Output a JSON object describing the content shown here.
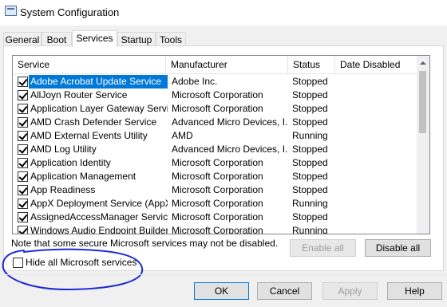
{
  "window": {
    "title": "System Configuration",
    "icon": "msconfig-icon"
  },
  "tabs": [
    {
      "label": "General"
    },
    {
      "label": "Boot"
    },
    {
      "label": "Services",
      "active": true
    },
    {
      "label": "Startup"
    },
    {
      "label": "Tools"
    }
  ],
  "services": {
    "columns": [
      "Service",
      "Manufacturer",
      "Status",
      "Date Disabled"
    ],
    "rows": [
      {
        "checked": true,
        "service": "Adobe Acrobat Update Service",
        "manufacturer": "Adobe Inc.",
        "status": "Stopped",
        "date_disabled": "",
        "selected": true
      },
      {
        "checked": true,
        "service": "AllJoyn Router Service",
        "manufacturer": "Microsoft Corporation",
        "status": "Stopped",
        "date_disabled": ""
      },
      {
        "checked": true,
        "service": "Application Layer Gateway Service",
        "manufacturer": "Microsoft Corporation",
        "status": "Stopped",
        "date_disabled": ""
      },
      {
        "checked": true,
        "service": "AMD Crash Defender Service",
        "manufacturer": "Advanced Micro Devices, I...",
        "status": "Stopped",
        "date_disabled": ""
      },
      {
        "checked": true,
        "service": "AMD External Events Utility",
        "manufacturer": "AMD",
        "status": "Running",
        "date_disabled": ""
      },
      {
        "checked": true,
        "service": "AMD Log Utility",
        "manufacturer": "Advanced Micro Devices, I...",
        "status": "Stopped",
        "date_disabled": ""
      },
      {
        "checked": true,
        "service": "Application Identity",
        "manufacturer": "Microsoft Corporation",
        "status": "Stopped",
        "date_disabled": ""
      },
      {
        "checked": true,
        "service": "Application Management",
        "manufacturer": "Microsoft Corporation",
        "status": "Stopped",
        "date_disabled": ""
      },
      {
        "checked": true,
        "service": "App Readiness",
        "manufacturer": "Microsoft Corporation",
        "status": "Stopped",
        "date_disabled": ""
      },
      {
        "checked": true,
        "service": "AppX Deployment Service (AppX...",
        "manufacturer": "Microsoft Corporation",
        "status": "Running",
        "date_disabled": ""
      },
      {
        "checked": true,
        "service": "AssignedAccessManager Service",
        "manufacturer": "Microsoft Corporation",
        "status": "Stopped",
        "date_disabled": ""
      },
      {
        "checked": true,
        "service": "Windows Audio Endpoint Builder",
        "manufacturer": "Microsoft Corporation",
        "status": "Running",
        "date_disabled": ""
      }
    ]
  },
  "note": "Note that some secure Microsoft services may not be disabled.",
  "buttons": {
    "enable_all": "Enable all",
    "disable_all": "Disable all",
    "ok": "OK",
    "cancel": "Cancel",
    "apply": "Apply",
    "help": "Help"
  },
  "hide_ms": {
    "label": "Hide all Microsoft services",
    "checked": false
  },
  "colors": {
    "selection": "#0078d7",
    "annotation": "#1c2bd6"
  }
}
